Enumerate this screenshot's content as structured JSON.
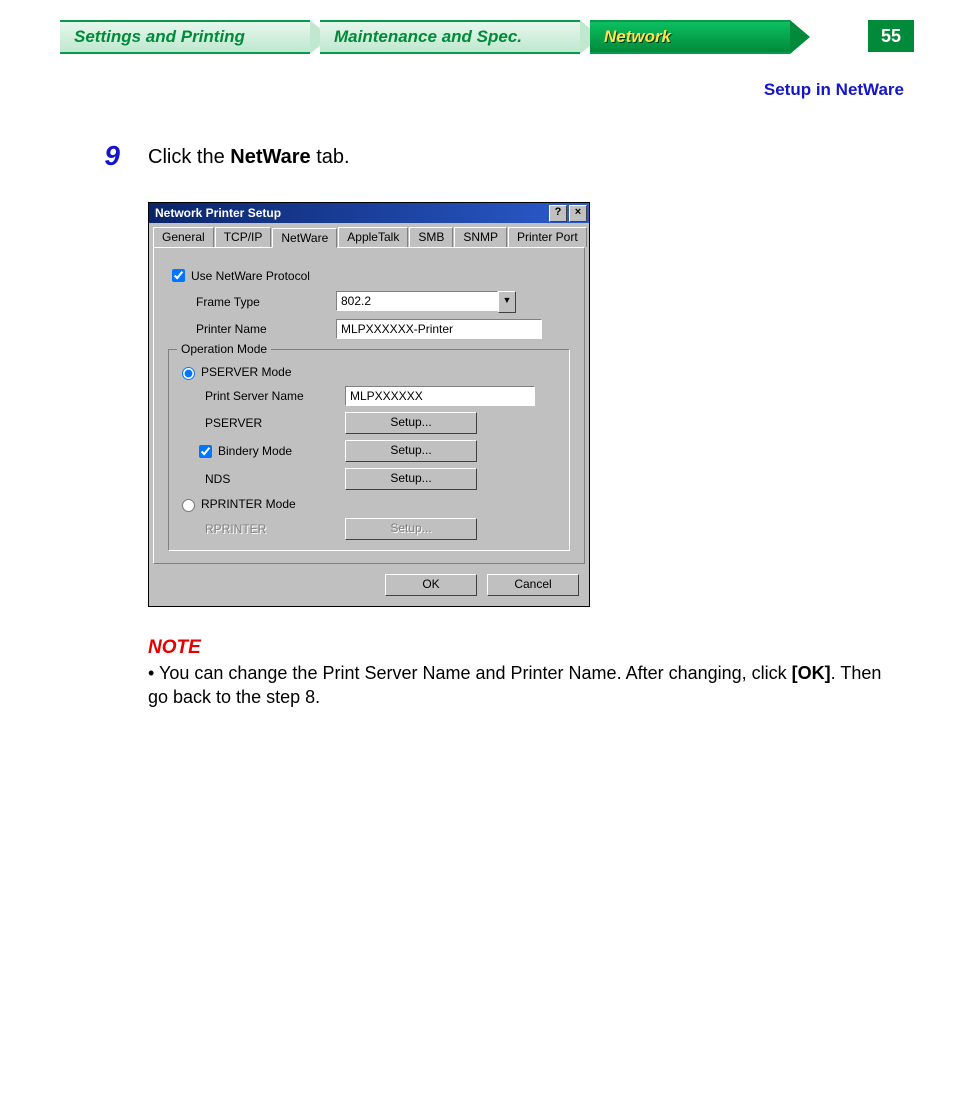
{
  "header": {
    "tabs": [
      "Settings and Printing",
      "Maintenance and Spec.",
      "Network"
    ],
    "active_index": 2,
    "page_number": "55",
    "section_link": "Setup in NetWare"
  },
  "step": {
    "number": "9",
    "prefix": "Click the ",
    "bold": "NetWare",
    "suffix": " tab."
  },
  "dialog": {
    "title": "Network Printer Setup",
    "tabs": [
      "General",
      "TCP/IP",
      "NetWare",
      "AppleTalk",
      "SMB",
      "SNMP",
      "Printer Port"
    ],
    "selected_tab_index": 2,
    "use_netware_label": "Use NetWare Protocol",
    "use_netware_checked": true,
    "frame_type_label": "Frame Type",
    "frame_type_value": "802.2",
    "printer_name_label": "Printer Name",
    "printer_name_value": "MLPXXXXXX-Printer",
    "operation_mode_label": "Operation Mode",
    "pserver_mode_label": "PSERVER Mode",
    "pserver_mode_selected": true,
    "print_server_name_label": "Print Server Name",
    "print_server_name_value": "MLPXXXXXX",
    "pserver_row_label": "PSERVER",
    "bindery_mode_label": "Bindery Mode",
    "bindery_mode_checked": true,
    "nds_label": "NDS",
    "rprinter_mode_label": "RPRINTER Mode",
    "rprinter_mode_selected": false,
    "rprinter_row_label": "RPRINTER",
    "setup_button": "Setup...",
    "ok_button": "OK",
    "cancel_button": "Cancel"
  },
  "note": {
    "label": "NOTE",
    "bullet_prefix": "• You can change the Print Server Name and Printer Name. After changing, click ",
    "bold": "[OK]",
    "suffix": ". Then go back to the step 8."
  }
}
